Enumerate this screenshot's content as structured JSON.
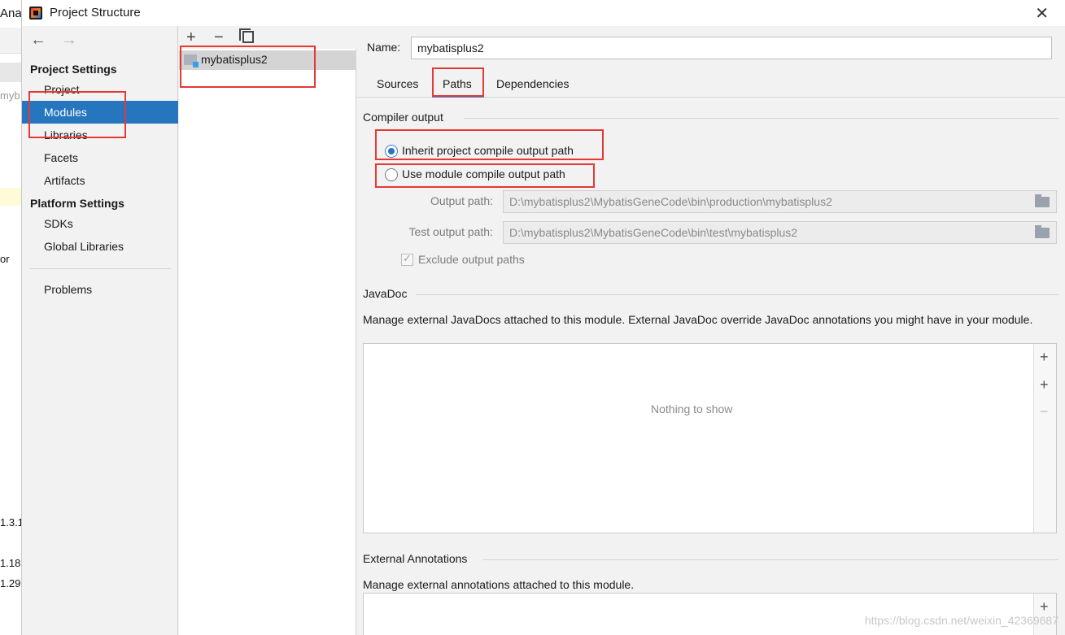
{
  "background_ide": {
    "fragments": [
      "Anal",
      "myb",
      "or",
      "1.3.1",
      "1.18",
      "1.29"
    ]
  },
  "dialog": {
    "title": "Project Structure",
    "close_icon": "close-icon"
  },
  "left_nav": {
    "back_glyph": "←",
    "forward_glyph": "→",
    "project_settings_header": "Project Settings",
    "project_settings_items": [
      "Project",
      "Modules",
      "Libraries",
      "Facets",
      "Artifacts"
    ],
    "platform_settings_header": "Platform Settings",
    "platform_settings_items": [
      "SDKs",
      "Global Libraries"
    ],
    "problems": "Problems",
    "selected": "Modules"
  },
  "module_list": {
    "add_glyph": "+",
    "remove_glyph": "−",
    "modules": [
      "mybatisplus2"
    ]
  },
  "right": {
    "name_label": "Name:",
    "name_value": "mybatisplus2",
    "tabs": [
      "Sources",
      "Paths",
      "Dependencies"
    ],
    "active_tab": "Paths",
    "compiler_output": {
      "title": "Compiler output",
      "inherit_label": "Inherit project compile output path",
      "use_module_label": "Use module compile output path",
      "output_path_label": "Output path:",
      "output_path_value": "D:\\mybatisplus2\\MybatisGeneCode\\bin\\production\\mybatisplus2",
      "test_output_path_label": "Test output path:",
      "test_output_path_value": "D:\\mybatisplus2\\MybatisGeneCode\\bin\\test\\mybatisplus2",
      "exclude_label": "Exclude output paths"
    },
    "javadoc": {
      "title": "JavaDoc",
      "description": "Manage external JavaDocs attached to this module. External JavaDoc override JavaDoc annotations you might have in your module.",
      "empty_text": "Nothing to show"
    },
    "external_annotations": {
      "title": "External Annotations",
      "description": "Manage external annotations attached to this module."
    }
  },
  "watermark": "https://blog.csdn.net/weixin_42369687",
  "colors": {
    "selection": "#2675bf",
    "highlight_box": "#e53935",
    "tab_underline": "#4083c9"
  }
}
